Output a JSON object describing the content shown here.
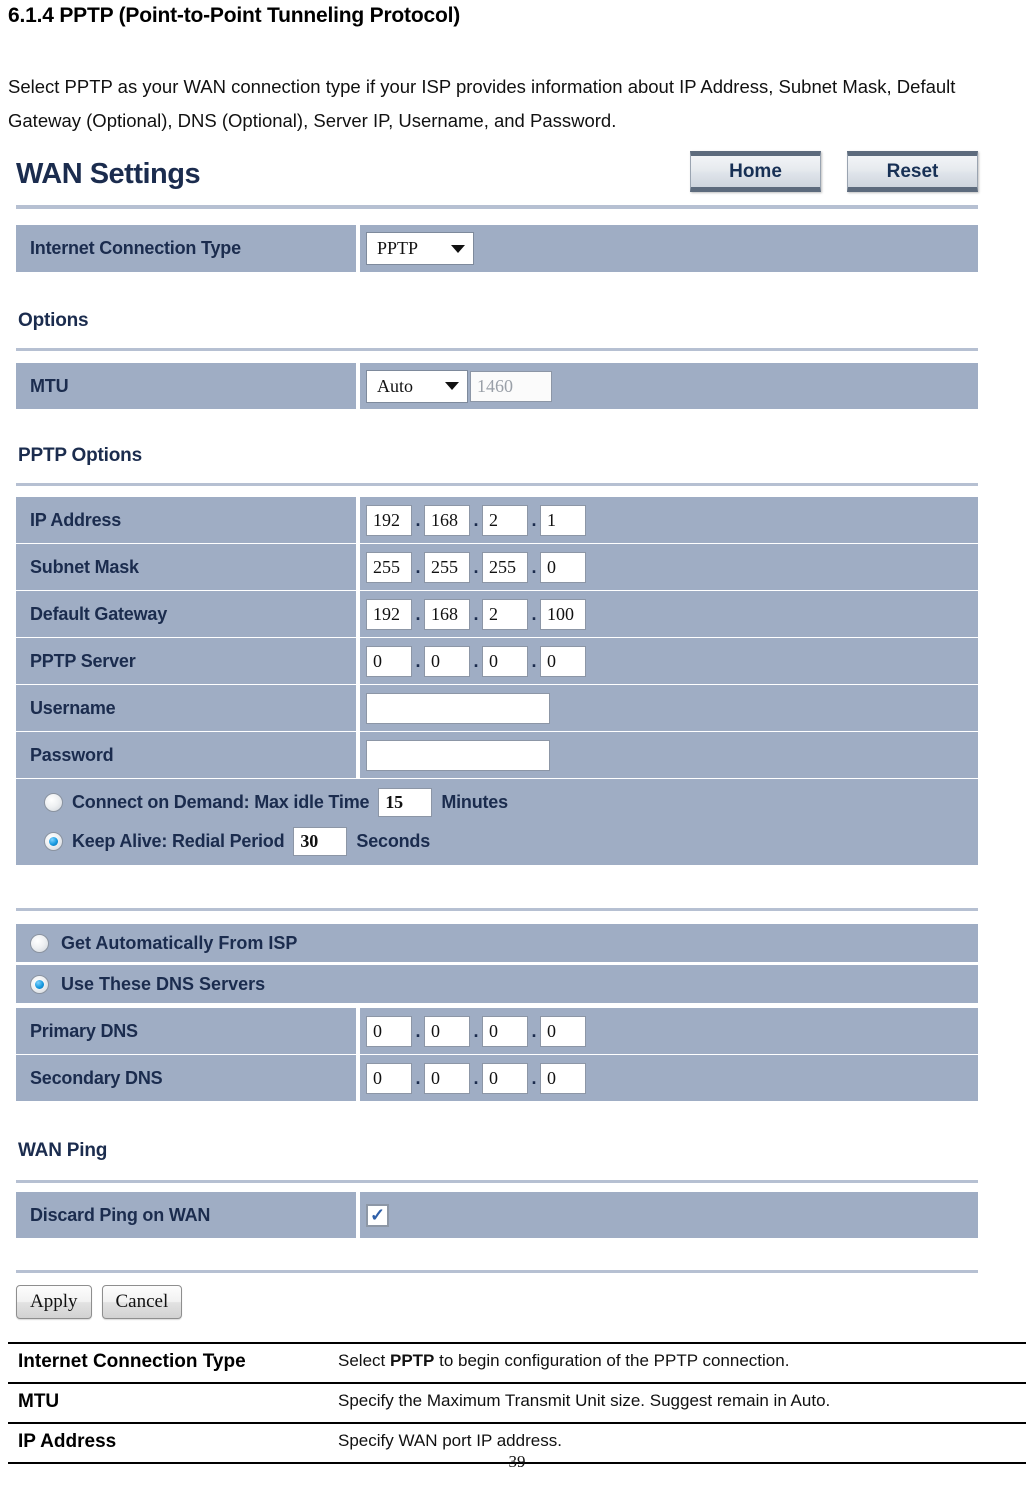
{
  "document": {
    "heading": "6.1.4 PPTP (Point-to-Point Tunneling Protocol)",
    "paragraph": "Select PPTP as your WAN connection type if your ISP provides information about IP Address, Subnet Mask, Default Gateway (Optional), DNS (Optional), Server IP, Username, and Password.",
    "page_number": "39"
  },
  "ui": {
    "title": "WAN Settings",
    "nav": {
      "home": "Home",
      "reset": "Reset"
    },
    "connection": {
      "label": "Internet Connection Type",
      "selected": "PPTP"
    },
    "options_section": {
      "title": "Options",
      "mtu": {
        "label": "MTU",
        "mode": "Auto",
        "size": "1460"
      }
    },
    "pptp_section": {
      "title": "PPTP Options",
      "rows": [
        {
          "label": "IP Address",
          "octets": [
            "192",
            "168",
            "2",
            "1"
          ]
        },
        {
          "label": "Subnet Mask",
          "octets": [
            "255",
            "255",
            "255",
            "0"
          ]
        },
        {
          "label": "Default Gateway",
          "octets": [
            "192",
            "168",
            "2",
            "100"
          ]
        },
        {
          "label": "PPTP Server",
          "octets": [
            "0",
            "0",
            "0",
            "0"
          ]
        }
      ],
      "username": {
        "label": "Username",
        "value": ""
      },
      "password": {
        "label": "Password",
        "value": ""
      },
      "connect_on_demand": {
        "text_before": "Connect on Demand: Max idle Time",
        "value": "15",
        "text_after": "Minutes",
        "selected": false
      },
      "keep_alive": {
        "text_before": "Keep Alive: Redial Period",
        "value": "30",
        "text_after": "Seconds",
        "selected": true
      }
    },
    "dns_section": {
      "auto_label": "Get Automatically From ISP",
      "auto_selected": false,
      "manual_label": "Use These DNS Servers",
      "manual_selected": true,
      "rows": [
        {
          "label": "Primary DNS",
          "octets": [
            "0",
            "0",
            "0",
            "0"
          ]
        },
        {
          "label": "Secondary DNS",
          "octets": [
            "0",
            "0",
            "0",
            "0"
          ]
        }
      ]
    },
    "wanping_section": {
      "title": "WAN Ping",
      "discard": {
        "label": "Discard Ping on WAN",
        "checked": true,
        "glyph": "✓"
      }
    },
    "actions": {
      "apply": "Apply",
      "cancel": "Cancel"
    }
  },
  "definitions": {
    "rows": [
      {
        "key": "Internet Connection Type",
        "pre": "Select ",
        "strong": "PPTP",
        "post": " to begin configuration of the PPTP connection."
      },
      {
        "key": "MTU",
        "pre": "Specify the Maximum Transmit Unit size. Suggest remain in Auto.",
        "strong": "",
        "post": ""
      },
      {
        "key": "IP Address",
        "pre": "Specify WAN port IP address.",
        "strong": "",
        "post": ""
      }
    ]
  },
  "colors": {
    "row_blue": "#9fadc4",
    "label_navy": "#1b2c4e",
    "rule_blue": "#b6c0d2",
    "radio_accent": "#179ae0"
  }
}
